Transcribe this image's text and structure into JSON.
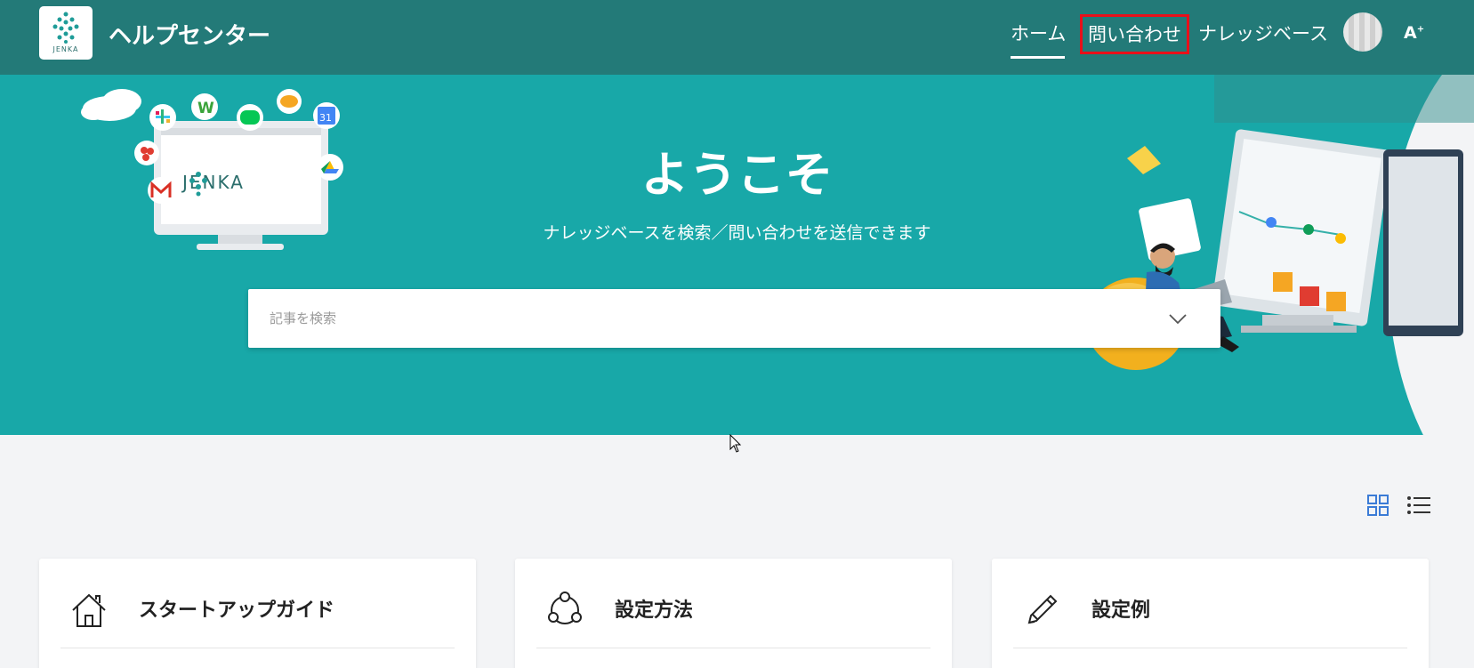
{
  "header": {
    "logo_text": "JENKA",
    "title": "ヘルプセンター",
    "nav": {
      "home": "ホーム",
      "contact": "問い合わせ",
      "knowledge_base": "ナレッジベース"
    },
    "font_size_button": "A",
    "font_size_sup": "+"
  },
  "hero": {
    "welcome": "ようこそ",
    "subtitle": "ナレッジベースを検索／問い合わせを送信できます",
    "illustration_logo_text": "JENKA"
  },
  "search": {
    "placeholder": "記事を検索",
    "value": ""
  },
  "categories": [
    {
      "title": "スタートアップガイド",
      "icon": "house-icon"
    },
    {
      "title": "設定方法",
      "icon": "share-network-icon"
    },
    {
      "title": "設定例",
      "icon": "pencil-icon"
    }
  ],
  "colors": {
    "header_bg": "#237a78",
    "hero_bg": "#18a8a8",
    "page_bg": "#f3f4f6",
    "highlight_border": "#e8101a",
    "view_toggle_active": "#3b7bd6"
  }
}
